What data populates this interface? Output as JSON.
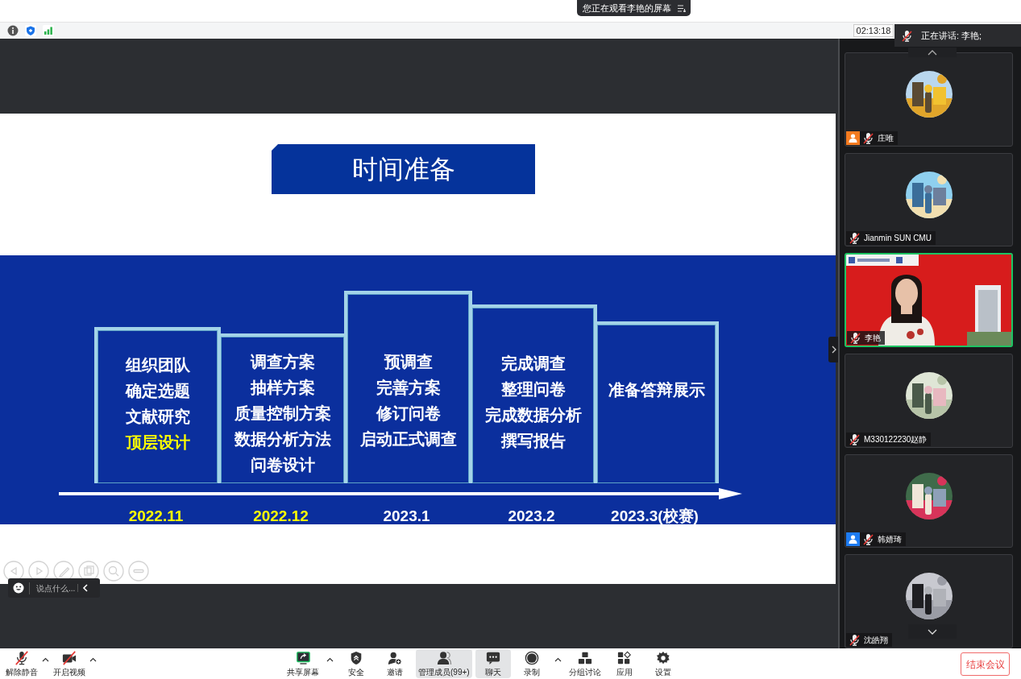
{
  "banner": {
    "text": "您正在观看李艳的屏幕"
  },
  "info_bar": {
    "time": "02:13:18"
  },
  "speaker": {
    "text": "正在讲话: 李艳;",
    "muted": true
  },
  "slide": {
    "title": "时间准备",
    "stages": [
      {
        "lines": [
          {
            "text": "组织团队",
            "highlight": false
          },
          {
            "text": "确定选题",
            "highlight": false
          },
          {
            "text": "文献研究",
            "highlight": false
          },
          {
            "text": "顶层设计",
            "highlight": true
          }
        ],
        "date": "2022.11",
        "date_highlight": true
      },
      {
        "lines": [
          {
            "text": "调查方案",
            "highlight": false
          },
          {
            "text": "抽样方案",
            "highlight": false
          },
          {
            "text": "质量控制方案",
            "highlight": false
          },
          {
            "text": "数据分析方法",
            "highlight": false
          },
          {
            "text": "问卷设计",
            "highlight": false
          }
        ],
        "date": "2022.12",
        "date_highlight": true
      },
      {
        "lines": [
          {
            "text": "预调查",
            "highlight": false
          },
          {
            "text": "完善方案",
            "highlight": false
          },
          {
            "text": "修订问卷",
            "highlight": false
          },
          {
            "text": "启动正式调查",
            "highlight": false
          }
        ],
        "date": "2023.1",
        "date_highlight": false
      },
      {
        "lines": [
          {
            "text": "完成调查",
            "highlight": false
          },
          {
            "text": "整理问卷",
            "highlight": false
          },
          {
            "text": "完成数据分析",
            "highlight": false
          },
          {
            "text": "撰写报告",
            "highlight": false
          }
        ],
        "date": "2023.2",
        "date_highlight": false
      },
      {
        "lines": [
          {
            "text": "准备答辩展示",
            "highlight": false
          }
        ],
        "date": "2023.3(校赛)",
        "date_highlight": false
      }
    ]
  },
  "chat": {
    "placeholder": "说点什么..."
  },
  "participants": [
    {
      "kind": "avatar",
      "name": "庄唯",
      "muted": true,
      "speaking": false,
      "badge": {
        "color": "#f47b20"
      }
    },
    {
      "kind": "avatar",
      "name": "Jianmin SUN CMU",
      "muted": true,
      "speaking": false
    },
    {
      "kind": "video",
      "name": "李艳",
      "muted": true,
      "speaking": true
    },
    {
      "kind": "avatar",
      "name": "M330122230赵静",
      "muted": true,
      "speaking": false
    },
    {
      "kind": "avatar",
      "name": "韩婧琦",
      "muted": true,
      "speaking": false,
      "badge": {
        "color": "#1e7cf2"
      }
    },
    {
      "kind": "avatar",
      "name": "沈皓翔",
      "muted": true,
      "speaking": false
    }
  ],
  "toolbar": {
    "left": [
      {
        "label": "解除静音",
        "off": true,
        "menu": true
      },
      {
        "label": "开启视频",
        "off": true,
        "menu": true
      }
    ],
    "center": [
      {
        "label": "共享屏幕",
        "menu": true,
        "selected": false
      },
      {
        "label": "安全",
        "menu": false,
        "selected": false
      },
      {
        "label": "邀请",
        "menu": false,
        "selected": false
      },
      {
        "label": "管理成员(99+)",
        "menu": false,
        "selected": true
      },
      {
        "label": "聊天",
        "menu": false,
        "selected": true
      },
      {
        "label": "录制",
        "menu": true,
        "selected": false
      },
      {
        "label": "分组讨论",
        "menu": false,
        "selected": false
      },
      {
        "label": "应用",
        "menu": false,
        "selected": false
      },
      {
        "label": "设置",
        "menu": false,
        "selected": false
      }
    ],
    "end_button": "结束会议"
  }
}
